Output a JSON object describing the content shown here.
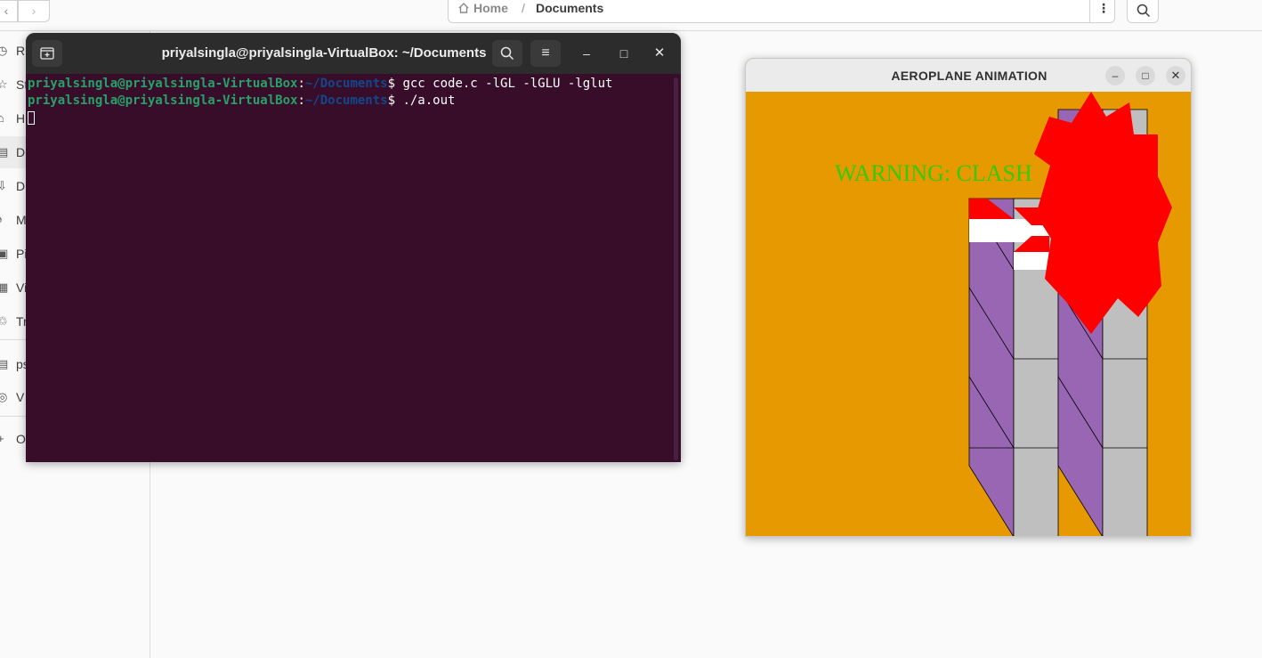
{
  "file_manager": {
    "breadcrumb": {
      "home": "Home",
      "separator": "/",
      "current": "Documents"
    },
    "sidebar": {
      "items": [
        {
          "icon": "clock-icon",
          "label": "R"
        },
        {
          "icon": "star-icon",
          "label": "St"
        },
        {
          "icon": "home-icon",
          "label": "H"
        },
        {
          "icon": "document-icon",
          "label": "D"
        },
        {
          "icon": "download-icon",
          "label": "D"
        },
        {
          "icon": "music-icon",
          "label": "M"
        },
        {
          "icon": "picture-icon",
          "label": "Pi"
        },
        {
          "icon": "video-icon",
          "label": "Vi"
        },
        {
          "icon": "trash-icon",
          "label": "Tr"
        },
        {
          "icon": "drive-icon",
          "label": "ps"
        },
        {
          "icon": "disc-icon",
          "label": "V"
        },
        {
          "icon": "plus-icon",
          "label": "O"
        }
      ]
    }
  },
  "terminal": {
    "title": "priyalsingla@priyalsingla-VirtualBox: ~/Documents",
    "lines": [
      {
        "user": "priyalsingla@priyalsingla-VirtualBox",
        "colon": ":",
        "path": "~/Documents",
        "prompt": "$ ",
        "command": "gcc code.c -lGL -lGLU -lglut"
      },
      {
        "user": "priyalsingla@priyalsingla-VirtualBox",
        "colon": ":",
        "path": "~/Documents",
        "prompt": "$ ",
        "command": "./a.out"
      }
    ]
  },
  "gl_window": {
    "title": "AEROPLANE ANIMATION",
    "warning_text": "WARNING: CLASH",
    "colors": {
      "background": "#e69900",
      "warning": "#33cc00",
      "explosion": "#ff0000",
      "tower_front": "#9966b3",
      "tower_side": "#bfbfbf"
    }
  }
}
